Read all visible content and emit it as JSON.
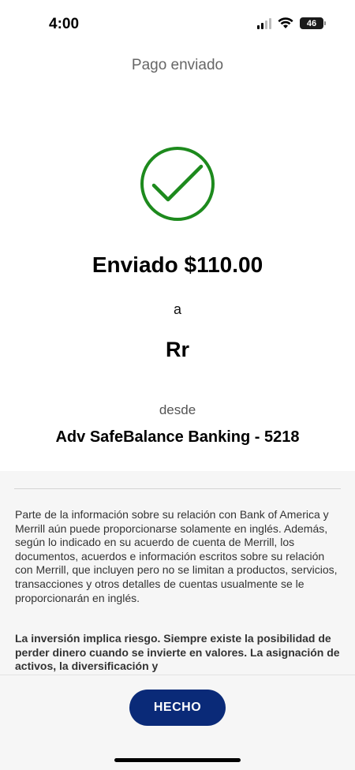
{
  "status_bar": {
    "time": "4:00",
    "battery": "46",
    "icons": [
      "signal-icon",
      "wifi-icon",
      "battery-icon"
    ]
  },
  "header": {
    "title": "Pago enviado"
  },
  "confirmation": {
    "icon": "checkmark-circle-icon",
    "icon_color": "#1d8a1d",
    "sent_amount": "Enviado $110.00",
    "to_label": "a",
    "recipient": "Rr",
    "from_label": "desde",
    "account": "Adv SafeBalance Banking - 5218"
  },
  "disclosure": {
    "paragraph": "Parte de la información sobre su relación con Bank of America y Merrill aún puede proporcionarse solamente en inglés. Además, según lo indicado en su acuerdo de cuenta de Merrill, los documentos, acuerdos e información escritos sobre su relación con Merrill, que incluyen pero no se limitan a productos, servicios, transacciones y otros detalles de cuentas usualmente se le proporcionarán en inglés.",
    "bold_paragraph": "La inversión implica riesgo. Siempre existe la posibilidad de perder dinero cuando se invierte en valores. La asignación de activos, la diversificación y"
  },
  "footer": {
    "done_label": "HECHO",
    "button_color": "#0a2a78"
  }
}
